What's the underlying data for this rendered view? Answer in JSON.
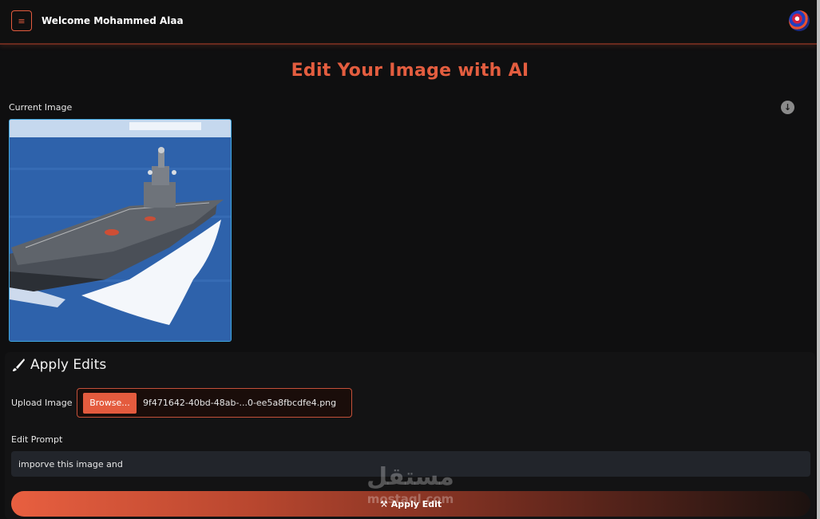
{
  "header": {
    "menu_icon": "≡",
    "welcome_text": "Welcome Mohammed Alaa",
    "logo_icon": "circular-logo"
  },
  "main": {
    "title": "Edit Your Image with AI",
    "current_image_label": "Current Image",
    "download_icon": "↓"
  },
  "apply_panel": {
    "title": "Apply Edits",
    "upload_label": "Upload Image",
    "browse_label": "Browse...",
    "file_name": "9f471642-40bd-48ab-...0-ee5a8fbcdfe4.png",
    "prompt_label": "Edit Prompt",
    "prompt_value": "imporve this image and",
    "apply_button_label": "Apply Edit",
    "apply_icon": "⚒"
  },
  "watermark": {
    "arabic": "مستقل",
    "latin": "mostaql.com"
  },
  "colors": {
    "accent": "#e45b3e",
    "background": "#0f0f10",
    "image_border": "#3fa7e0"
  }
}
